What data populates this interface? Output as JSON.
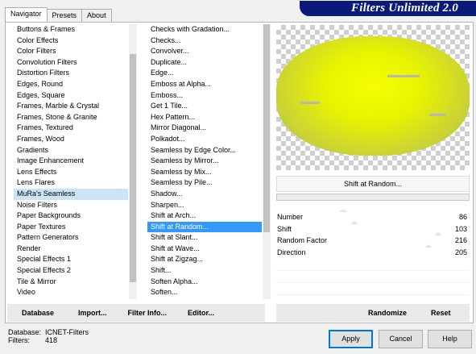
{
  "tabs": [
    "Navigator",
    "Presets",
    "About"
  ],
  "banner": "Filters Unlimited 2.0",
  "categories": [
    "Buttons & Frames",
    "Color Effects",
    "Color Filters",
    "Convolution Filters",
    "Distortion Filters",
    "Edges, Round",
    "Edges, Square",
    "Frames, Marble & Crystal",
    "Frames, Stone & Granite",
    "Frames, Textured",
    "Frames, Wood",
    "Gradients",
    "Image Enhancement",
    "Lens Effects",
    "Lens Flares",
    "MuRa's Seamless",
    "Noise Filters",
    "Paper Backgrounds",
    "Paper Textures",
    "Pattern Generators",
    "Render",
    "Special Effects 1",
    "Special Effects 2",
    "Tile & Mirror",
    "Video"
  ],
  "selected_category": "MuRa's Seamless",
  "filters": [
    "Checks with Gradation...",
    "Checks...",
    "Convolver...",
    "Duplicate...",
    "Edge...",
    "Emboss at Alpha...",
    "Emboss...",
    "Get 1 Tile...",
    "Hex Pattern...",
    "Mirror Diagonal...",
    "Polkadot...",
    "Seamless by Edge Color...",
    "Seamless by Mirror...",
    "Seamless by Mix...",
    "Seamless by Pile...",
    "Shadow...",
    "Sharpen...",
    "Shift at Arch...",
    "Shift at Random...",
    "Shift at Slant...",
    "Shift at Wave...",
    "Shift at Zigzag...",
    "Shift...",
    "Soften Alpha...",
    "Soften..."
  ],
  "selected_filter": "Shift at Random...",
  "current_filter_name": "Shift at Random...",
  "params": [
    {
      "label": "Number",
      "value": "86",
      "fraction": 0.34
    },
    {
      "label": "Shift",
      "value": "103",
      "fraction": 0.4
    },
    {
      "label": "Random Factor",
      "value": "216",
      "fraction": 0.85
    },
    {
      "label": "Direction",
      "value": "205",
      "fraction": 0.8
    }
  ],
  "bottom_left": {
    "database": "Database",
    "import": "Import...",
    "filter_info": "Filter Info...",
    "editor": "Editor..."
  },
  "bottom_right": {
    "randomize": "Randomize",
    "reset": "Reset"
  },
  "status": {
    "database_label": "Database:",
    "database_value": "ICNET-Filters",
    "filters_label": "Filters:",
    "filters_value": "418"
  },
  "buttons": {
    "apply": "Apply",
    "cancel": "Cancel",
    "help": "Help"
  },
  "colors": {
    "banner_bg": "#0a1a7a",
    "selection": "#3399ff",
    "preview_yellow": "#f6ff00"
  }
}
